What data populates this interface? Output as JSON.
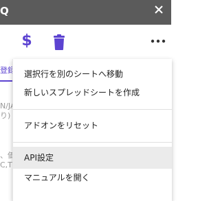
{
  "titlebar": {
    "title_fragment": "Q",
    "close_icon": "close-icon"
  },
  "toolbar": {
    "dollar_label": "$",
    "trash_icon": "trash-icon",
    "more_icon": "more-horizontal-icon",
    "accent_color": "#5c43d1"
  },
  "background": {
    "tab_label": "登録",
    "lines": [
      "N/JA",
      "り)",
      "、価",
      "C,TS"
    ]
  },
  "menu": {
    "items": [
      {
        "label": "選択行を別のシートへ移動"
      },
      {
        "label": "新しいスプレッドシートを作成"
      },
      {
        "label": "アドオンをリセット"
      },
      {
        "label": "API設定"
      },
      {
        "label": "マニュアルを開く"
      }
    ]
  }
}
